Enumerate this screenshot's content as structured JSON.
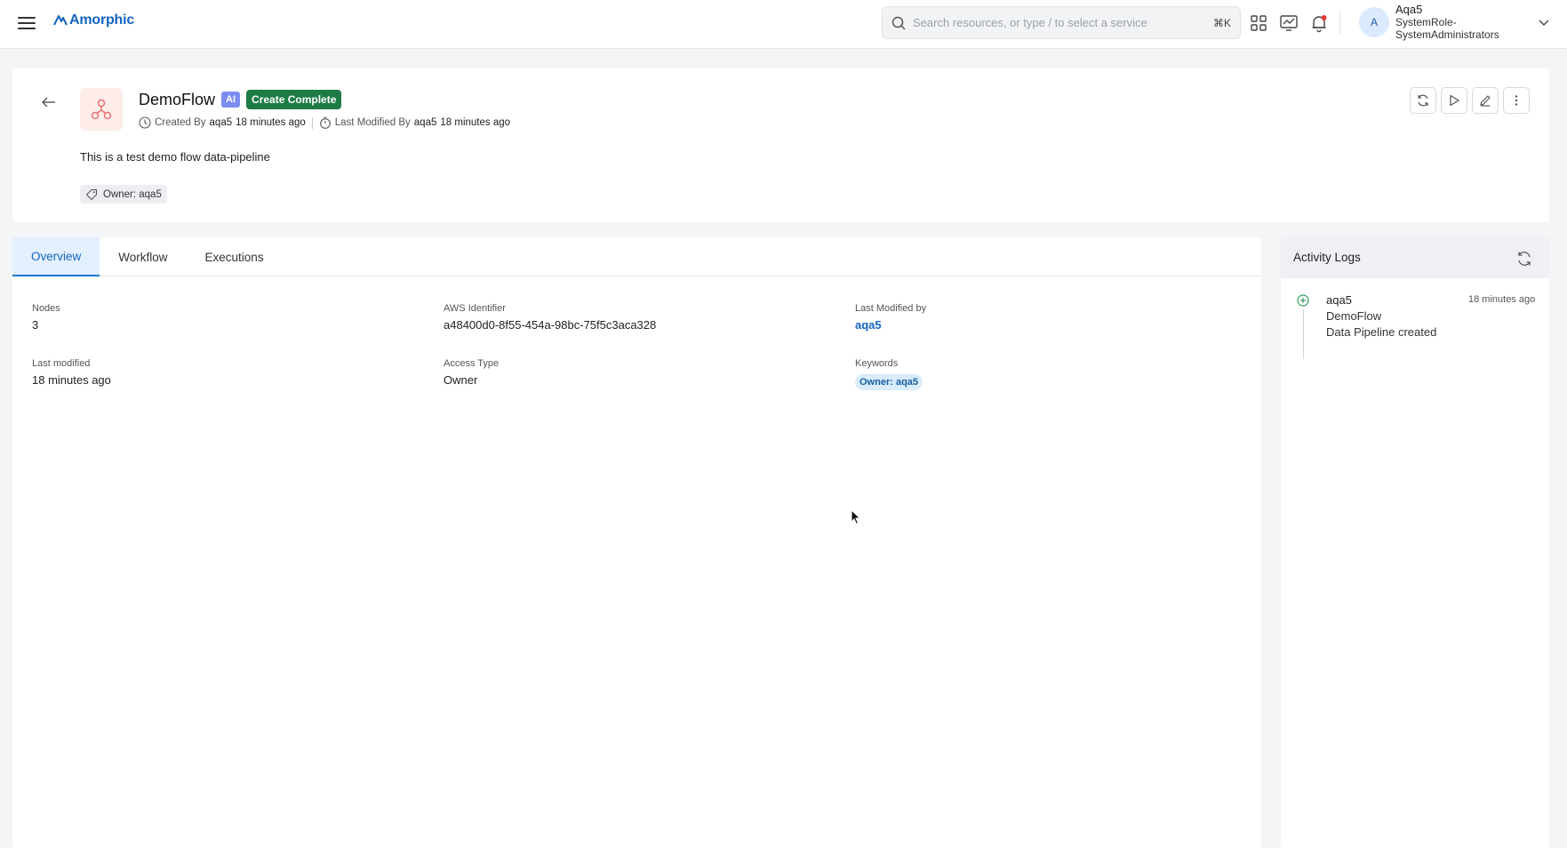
{
  "app": {
    "logo_text": "Amorphic"
  },
  "search": {
    "placeholder": "Search resources, or type / to select a service",
    "shortcut": "⌘K"
  },
  "user": {
    "initial": "A",
    "name": "Aqa5",
    "role_line1": "SystemRole-",
    "role_line2": "SystemAdministrators"
  },
  "header": {
    "title": "DemoFlow",
    "ai_badge": "AI",
    "status": "Create Complete",
    "created_by_label": "Created By",
    "created_by_user": "aqa5",
    "created_time": "18 minutes ago",
    "modified_by_label": "Last Modified By",
    "modified_by_user": "aqa5",
    "modified_time": "18 minutes ago",
    "description": "This is a test demo flow data-pipeline",
    "owner_tag": "Owner: aqa5"
  },
  "tabs": [
    {
      "label": "Overview",
      "active": true
    },
    {
      "label": "Workflow",
      "active": false
    },
    {
      "label": "Executions",
      "active": false
    }
  ],
  "overview": {
    "nodes_label": "Nodes",
    "nodes_value": "3",
    "aws_id_label": "AWS Identifier",
    "aws_id_value": "a48400d0-8f55-454a-98bc-75f5c3aca328",
    "last_modified_by_label": "Last Modified by",
    "last_modified_by_value": "aqa5",
    "last_modified_label": "Last modified",
    "last_modified_value": "18 minutes ago",
    "access_type_label": "Access Type",
    "access_type_value": "Owner",
    "keywords_label": "Keywords",
    "keywords": [
      "Owner: aqa5"
    ]
  },
  "activity_logs": {
    "title": "Activity Logs",
    "entries": [
      {
        "user": "aqa5",
        "time": "18 minutes ago",
        "resource": "DemoFlow",
        "action": "Data Pipeline created"
      }
    ]
  },
  "colors": {
    "brand": "#1565c0",
    "status_green": "#1e7b45",
    "ai_badge": "#7c8cf0",
    "notification_dot": "#e53935",
    "log_dot": "#2e9e5b"
  }
}
